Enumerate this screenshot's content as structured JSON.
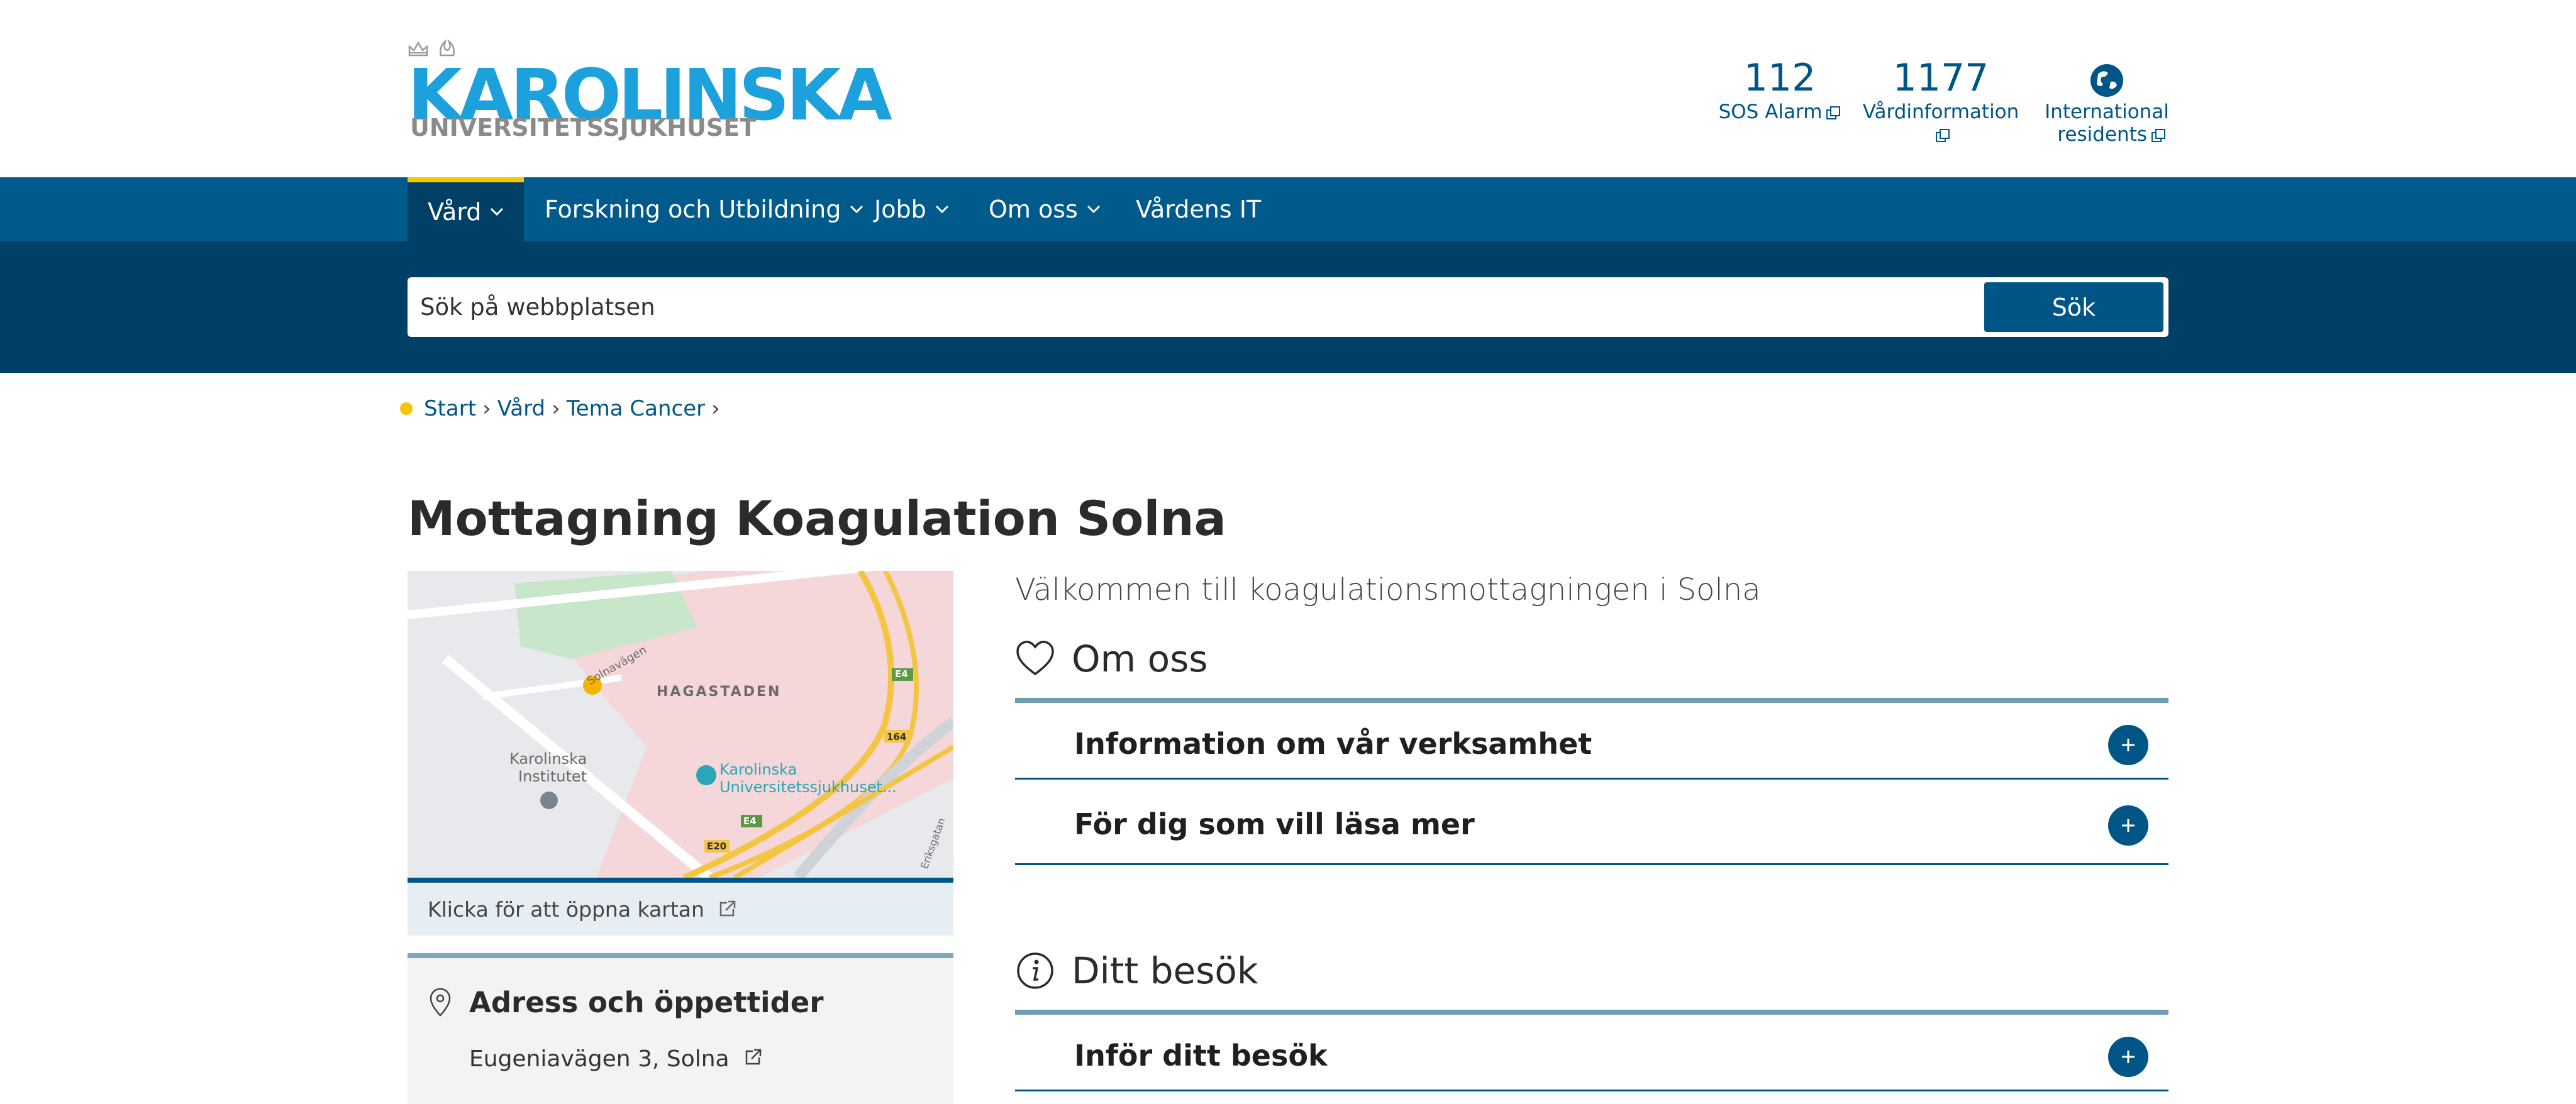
{
  "header": {
    "logo_main": "KAROLINSKA",
    "logo_sub": "UNIVERSITETSSJUKHUSET",
    "quick_links": [
      {
        "number": "112",
        "label": "SOS Alarm"
      },
      {
        "number": "1177",
        "label": "Vårdinformation"
      },
      {
        "label_line1": "International",
        "label_line2": "residents"
      }
    ]
  },
  "nav": {
    "items": [
      "Vård",
      "Forskning och Utbildning",
      "Jobb",
      "Om oss",
      "Vårdens IT"
    ]
  },
  "search": {
    "placeholder": "Sök på webbplatsen",
    "button": "Sök"
  },
  "breadcrumb": [
    "Start",
    "Vård",
    "Tema Cancer"
  ],
  "page": {
    "title": "Mottagning Koagulation Solna",
    "welcome": "Välkommen till koagulationsmottagningen i Solna"
  },
  "map": {
    "labels": {
      "area": "HAGASTADEN",
      "road": "Solnavägen",
      "ki_line1": "Karolinska",
      "ki_line2": "Institutet",
      "hospital_line1": "Karolinska",
      "hospital_line2": "Universitetssjukhuset...",
      "e4": "E4",
      "r164": "164",
      "e20": "E20",
      "e4b": "E4",
      "erik": "Eriksgatan"
    },
    "open_link": "Klicka för att öppna kartan"
  },
  "address": {
    "title": "Adress och öppettider",
    "street": "Eugeniavägen 3, Solna"
  },
  "sections": [
    {
      "title": "Om oss",
      "items": [
        "Information om vår verksamhet",
        "För dig som vill läsa mer"
      ]
    },
    {
      "title": "Ditt besök",
      "items": [
        "Inför ditt besök"
      ]
    }
  ],
  "colors": {
    "brand_blue": "#1da1dd",
    "nav_bg": "#005a8b",
    "search_band": "#003f66",
    "accent_yellow": "#f6c400",
    "link": "#005587"
  }
}
